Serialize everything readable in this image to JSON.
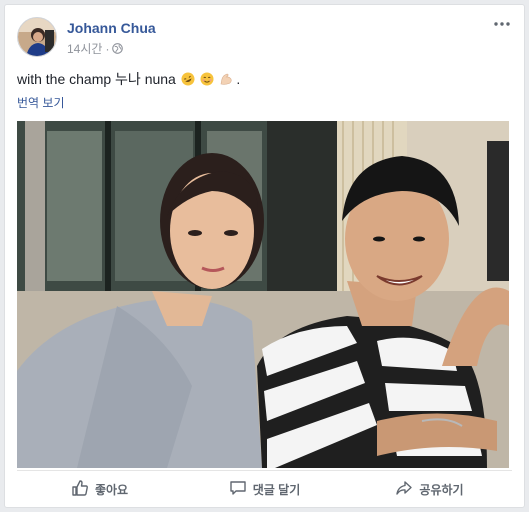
{
  "post": {
    "author": "Johann Chua",
    "time": "14시간",
    "separator": "·",
    "privacy_icon": "globe-icon",
    "more_icon": "more-dots-icon",
    "text": "with the champ 누나 nuna",
    "emojis": [
      "rolling-on-floor-laughing-emoji",
      "smiling-face-emoji",
      "flexed-biceps-emoji"
    ],
    "text_end": ".",
    "translate_label": "번역 보기"
  },
  "actions": {
    "like_label": "좋아요",
    "comment_label": "댓글 달기",
    "share_label": "공유하기"
  },
  "colors": {
    "link": "#365899",
    "meta": "#90949c",
    "action_text": "#606770",
    "background": "#e9ebee"
  }
}
